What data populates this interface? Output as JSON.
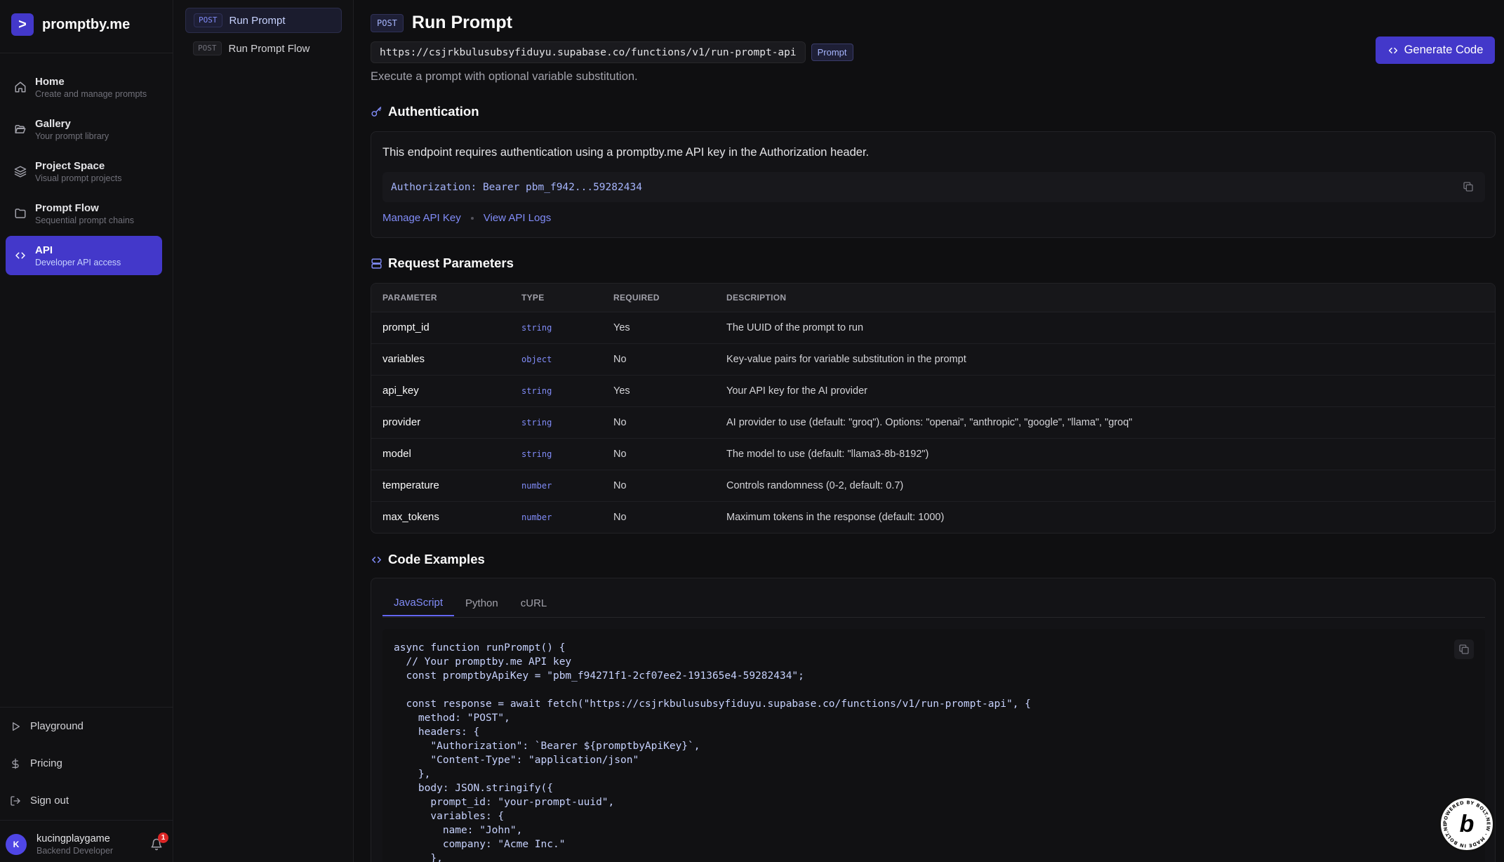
{
  "brand": {
    "logo_glyph": ">",
    "name": "promptby.me"
  },
  "nav": [
    {
      "icon": "home-icon",
      "title": "Home",
      "subtitle": "Create and manage prompts"
    },
    {
      "icon": "folder-open-icon",
      "title": "Gallery",
      "subtitle": "Your prompt library"
    },
    {
      "icon": "layers-icon",
      "title": "Project Space",
      "subtitle": "Visual prompt projects"
    },
    {
      "icon": "folder-icon",
      "title": "Prompt Flow",
      "subtitle": "Sequential prompt chains"
    },
    {
      "icon": "code-icon",
      "title": "API",
      "subtitle": "Developer API access",
      "active": true
    }
  ],
  "bottom_nav": [
    {
      "icon": "play-icon",
      "label": "Playground"
    },
    {
      "icon": "dollar-icon",
      "label": "Pricing"
    },
    {
      "icon": "sign-out-icon",
      "label": "Sign out"
    }
  ],
  "user": {
    "initial": "K",
    "name": "kucingplaygame",
    "role": "Backend Developer",
    "notifications": "1"
  },
  "endpoints": [
    {
      "method": "POST",
      "label": "Run Prompt",
      "active": true
    },
    {
      "method": "POST",
      "label": "Run Prompt Flow",
      "active": false
    }
  ],
  "header": {
    "method": "POST",
    "title": "Run Prompt",
    "url": "https://csjrkbulusubsyfiduyu.supabase.co/functions/v1/run-prompt-api",
    "badge": "Prompt",
    "description": "Execute a prompt with optional variable substitution.",
    "generate_button": "Generate Code"
  },
  "auth": {
    "title": "Authentication",
    "text": "This endpoint requires authentication using a promptby.me API key in the Authorization header.",
    "header_example": "Authorization: Bearer pbm_f942...59282434",
    "manage_link": "Manage API Key",
    "logs_link": "View API Logs"
  },
  "params": {
    "title": "Request Parameters",
    "columns": [
      "PARAMETER",
      "TYPE",
      "REQUIRED",
      "DESCRIPTION"
    ],
    "rows": [
      {
        "name": "prompt_id",
        "type": "string",
        "required": "Yes",
        "description": "The UUID of the prompt to run"
      },
      {
        "name": "variables",
        "type": "object",
        "required": "No",
        "description": "Key-value pairs for variable substitution in the prompt"
      },
      {
        "name": "api_key",
        "type": "string",
        "required": "Yes",
        "description": "Your API key for the AI provider"
      },
      {
        "name": "provider",
        "type": "string",
        "required": "No",
        "description": "AI provider to use (default: \"groq\"). Options: \"openai\", \"anthropic\", \"google\", \"llama\", \"groq\""
      },
      {
        "name": "model",
        "type": "string",
        "required": "No",
        "description": "The model to use (default: \"llama3-8b-8192\")"
      },
      {
        "name": "temperature",
        "type": "number",
        "required": "No",
        "description": "Controls randomness (0-2, default: 0.7)"
      },
      {
        "name": "max_tokens",
        "type": "number",
        "required": "No",
        "description": "Maximum tokens in the response (default: 1000)"
      }
    ]
  },
  "examples": {
    "title": "Code Examples",
    "tabs": [
      "JavaScript",
      "Python",
      "cURL"
    ],
    "active_tab": "JavaScript",
    "code": "async function runPrompt() {\n  // Your promptby.me API key\n  const promptbyApiKey = \"pbm_f94271f1-2cf07ee2-191365e4-59282434\";\n\n  const response = await fetch(\"https://csjrkbulusubsyfiduyu.supabase.co/functions/v1/run-prompt-api\", {\n    method: \"POST\",\n    headers: {\n      \"Authorization\": `Bearer ${promptbyApiKey}`,\n      \"Content-Type\": \"application/json\"\n    },\n    body: JSON.stringify({\n      prompt_id: \"your-prompt-uuid\",\n      variables: {\n        name: \"John\",\n        company: \"Acme Inc.\"\n      },"
  },
  "badge": {
    "letter": "b",
    "ring_text": "POWERED BY BOLT.NEW · MADE IN BOLT.NEW"
  },
  "colors": {
    "accent": "#4338ca",
    "accent_text": "#818cf8",
    "success": "#4ade80",
    "background": "#0f0f11"
  }
}
